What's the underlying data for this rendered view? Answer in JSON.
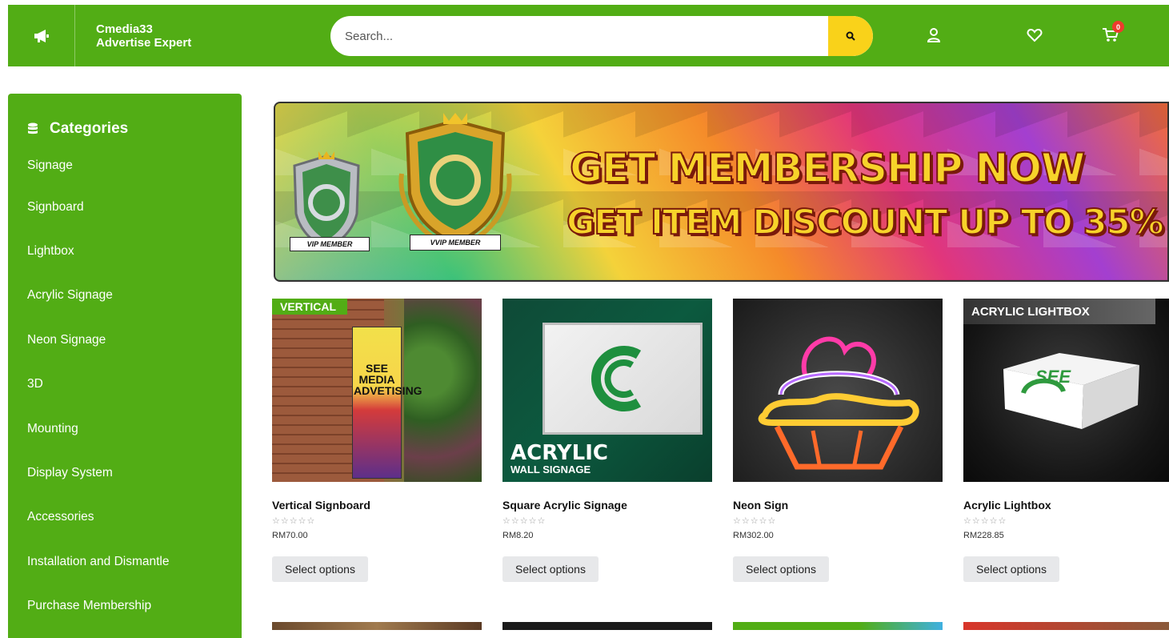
{
  "header": {
    "brand_line1": "Cmedia33",
    "brand_line2": "Advertise Expert",
    "search_placeholder": "Search...",
    "cart_count": "0"
  },
  "sidebar": {
    "title": "Categories",
    "items": [
      {
        "label": "Signage"
      },
      {
        "label": "Signboard"
      },
      {
        "label": "Lightbox"
      },
      {
        "label": "Acrylic Signage"
      },
      {
        "label": "Neon Signage"
      },
      {
        "label": "3D"
      },
      {
        "label": "Mounting"
      },
      {
        "label": "Display System"
      },
      {
        "label": "Accessories"
      },
      {
        "label": "Installation and Dismantle"
      },
      {
        "label": "Purchase Membership"
      }
    ]
  },
  "banner": {
    "line1": "GET MEMBERSHIP NOW",
    "line2": "GET ITEM DISCOUNT UP TO 35%",
    "badge_vip": "VIP MEMBER",
    "badge_vvip": "VVIP MEMBER"
  },
  "products": [
    {
      "name": "Vertical Signboard",
      "price": "RM70.00",
      "button": "Select options",
      "image_tag": "VERTICAL",
      "image_text": "SEE MEDIA ADVETISING"
    },
    {
      "name": "Square Acrylic Signage",
      "price": "RM8.20",
      "button": "Select options",
      "image_text_1": "ACRYLIC",
      "image_text_2": "WALL SIGNAGE"
    },
    {
      "name": "Neon Sign",
      "price": "RM302.00",
      "button": "Select options"
    },
    {
      "name": "Acrylic Lightbox",
      "price": "RM228.85",
      "button": "Select options",
      "image_tag": "ACRYLIC LIGHTBOX",
      "image_text": "SEE"
    }
  ],
  "rating_stars": "☆☆☆☆☆",
  "colors": {
    "brand_green": "#52ad15",
    "search_button": "#f9d21a",
    "badge_red": "#ee3b2d",
    "button_gray": "#e7e8ea"
  }
}
